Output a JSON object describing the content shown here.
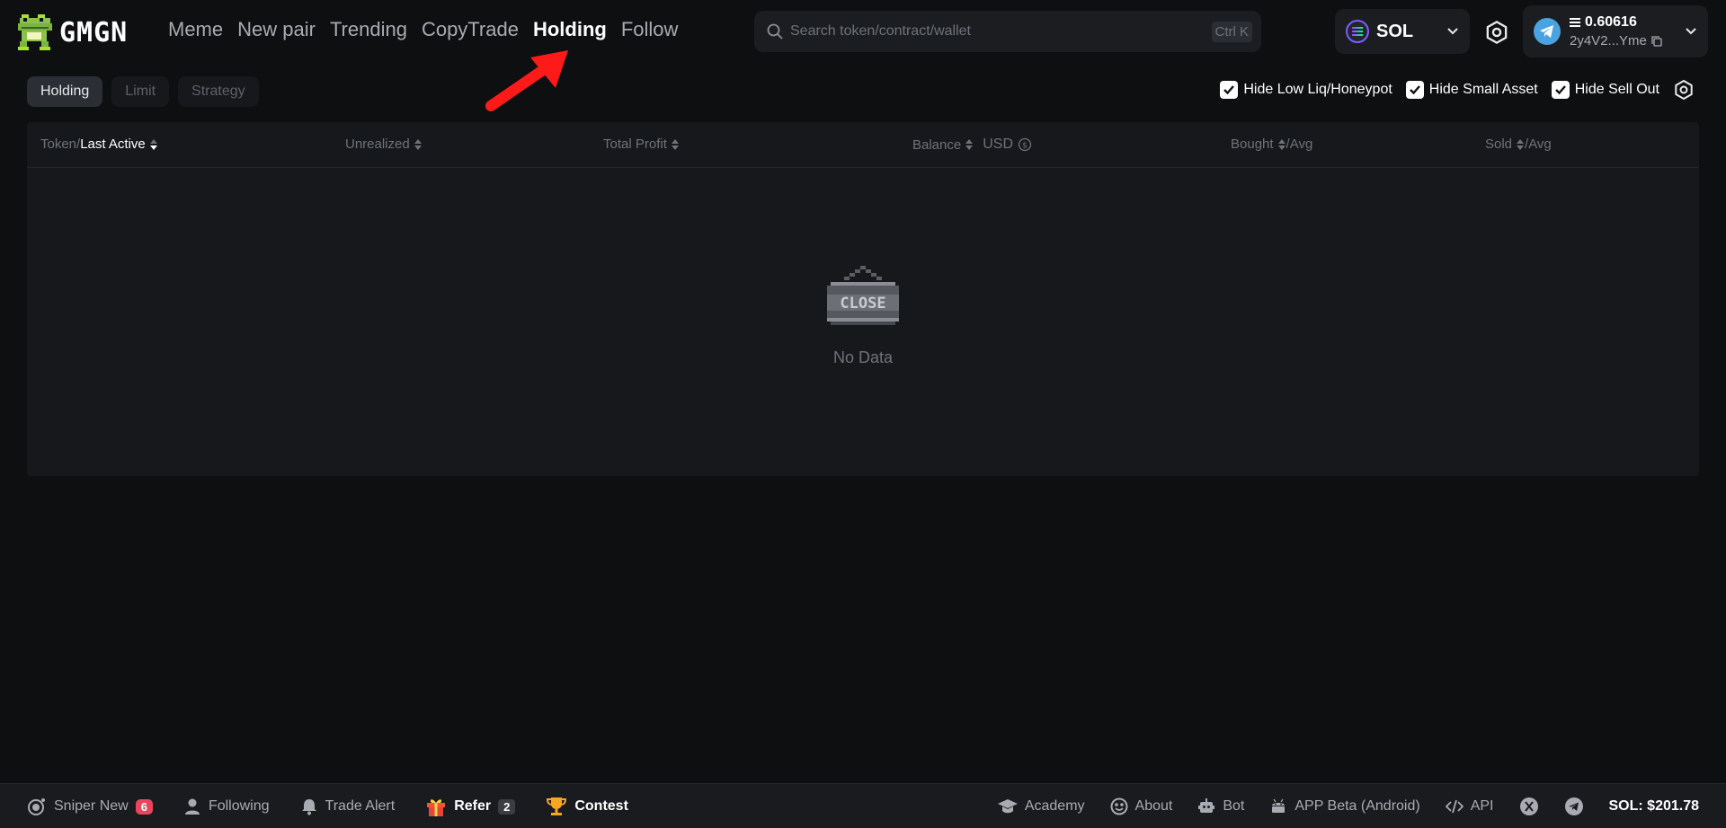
{
  "brand": {
    "name": "GMGN"
  },
  "nav": [
    {
      "label": "Meme"
    },
    {
      "label": "New pair"
    },
    {
      "label": "Trending"
    },
    {
      "label": "CopyTrade"
    },
    {
      "label": "Holding",
      "active": true
    },
    {
      "label": "Follow"
    }
  ],
  "search": {
    "placeholder": "Search token/contract/wallet",
    "shortcut": "Ctrl K"
  },
  "chain": {
    "name": "SOL"
  },
  "wallet": {
    "balance": "0.60616",
    "address": "2y4V2...Yme"
  },
  "subtabs": [
    {
      "label": "Holding",
      "active": true
    },
    {
      "label": "Limit"
    },
    {
      "label": "Strategy"
    }
  ],
  "filters": [
    {
      "label": "Hide Low Liq/Honeypot",
      "checked": true
    },
    {
      "label": "Hide Small Asset",
      "checked": true
    },
    {
      "label": "Hide Sell Out",
      "checked": true
    }
  ],
  "table": {
    "col_token_prefix": "Token/",
    "col_token_sort": "Last Active",
    "col_unrealized": "Unrealized",
    "col_total_profit": "Total Profit",
    "col_balance": "Balance",
    "col_currency": "USD",
    "col_bought": "Bought",
    "col_bought_avg": "/Avg",
    "col_sold": "Sold",
    "col_sold_avg": "/Avg",
    "empty_sign": "CLOSE",
    "empty_text": "No Data"
  },
  "footer": {
    "sniper": "Sniper New",
    "sniper_count": "6",
    "following": "Following",
    "trade_alert": "Trade Alert",
    "refer": "Refer",
    "refer_count": "2",
    "contest": "Contest",
    "academy": "Academy",
    "about": "About",
    "bot": "Bot",
    "app_beta": "APP Beta (Android)",
    "api": "API",
    "sol_price": "SOL: $201.78"
  },
  "colors": {
    "accent_red": "#ff1a1a",
    "badge_red": "#e8455f",
    "telegram": "#4aa3e0"
  }
}
